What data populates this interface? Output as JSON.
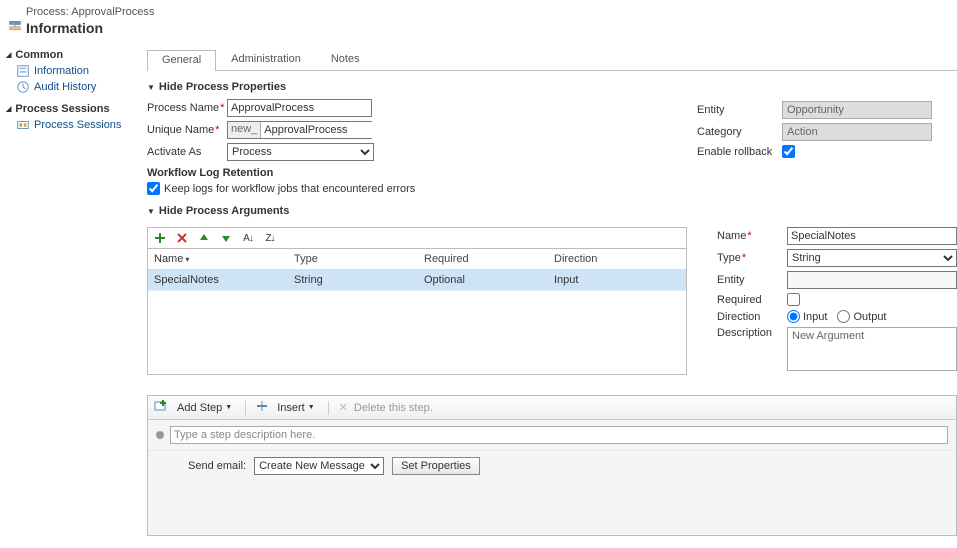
{
  "header": {
    "process_line": "Process: ApprovalProcess",
    "title": "Information"
  },
  "sidebar": {
    "groups": [
      {
        "title": "Common",
        "items": [
          {
            "label": "Information",
            "icon": "form-icon"
          },
          {
            "label": "Audit History",
            "icon": "history-icon"
          }
        ]
      },
      {
        "title": "Process Sessions",
        "items": [
          {
            "label": "Process Sessions",
            "icon": "sessions-icon"
          }
        ]
      }
    ]
  },
  "tabs": [
    "General",
    "Administration",
    "Notes"
  ],
  "section_props_title": "Hide Process Properties",
  "section_args_title": "Hide Process Arguments",
  "props": {
    "process_name_label": "Process Name",
    "process_name_value": "ApprovalProcess",
    "unique_name_label": "Unique Name",
    "unique_name_prefix": "new_",
    "unique_name_value": "ApprovalProcess",
    "activate_as_label": "Activate As",
    "activate_as_value": "Process",
    "workflow_log_title": "Workflow Log Retention",
    "workflow_log_checkbox_label": "Keep logs for workflow jobs that encountered errors",
    "workflow_log_checked": true,
    "entity_label": "Entity",
    "entity_value": "Opportunity",
    "category_label": "Category",
    "category_value": "Action",
    "enable_rollback_label": "Enable rollback",
    "enable_rollback_checked": true
  },
  "arg_grid": {
    "columns": [
      "Name",
      "Type",
      "Required",
      "Direction"
    ],
    "sort_col": 0,
    "rows": [
      {
        "name": "SpecialNotes",
        "type": "String",
        "required": "Optional",
        "direction": "Input"
      }
    ]
  },
  "arg_detail": {
    "name_label": "Name",
    "name_value": "SpecialNotes",
    "type_label": "Type",
    "type_value": "String",
    "entity_label": "Entity",
    "entity_value": "",
    "required_label": "Required",
    "required_checked": false,
    "direction_label": "Direction",
    "direction_value": "Input",
    "direction_option_input": "Input",
    "direction_option_output": "Output",
    "description_label": "Description",
    "description_value": "New Argument"
  },
  "steps": {
    "add_step_label": "Add Step",
    "insert_label": "Insert",
    "delete_label": "Delete this step.",
    "step_desc_placeholder": "Type a step description here.",
    "send_email_label": "Send email:",
    "send_email_select": "Create New Message",
    "set_properties_label": "Set Properties"
  }
}
